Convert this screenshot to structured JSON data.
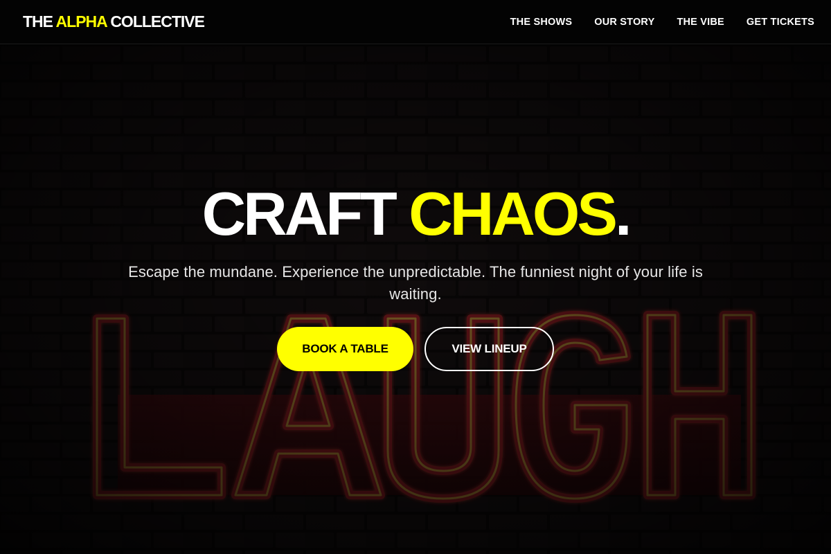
{
  "brand": {
    "prefix": "THE",
    "accent": "ALPHA",
    "suffix": "COLLECTIVE"
  },
  "nav": {
    "links": [
      {
        "label": "THE SHOWS"
      },
      {
        "label": "OUR STORY"
      },
      {
        "label": "THE VIBE"
      },
      {
        "label": "GET TICKETS"
      }
    ]
  },
  "hero": {
    "headline_main": "CRAFT",
    "headline_accent": "CHAOS",
    "headline_end": ".",
    "subtitle": "Escape the mundane. Experience the unpredictable. The funniest night of your life is waiting.",
    "primary_cta": "BOOK A TABLE",
    "secondary_cta": "VIEW LINEUP",
    "background_sign_text": "LAUGH"
  },
  "colors": {
    "accent": "#ffff00",
    "background": "#000000",
    "text": "#ffffff",
    "neon_red": "#c4202a",
    "neon_yellow": "#e8d23a"
  }
}
